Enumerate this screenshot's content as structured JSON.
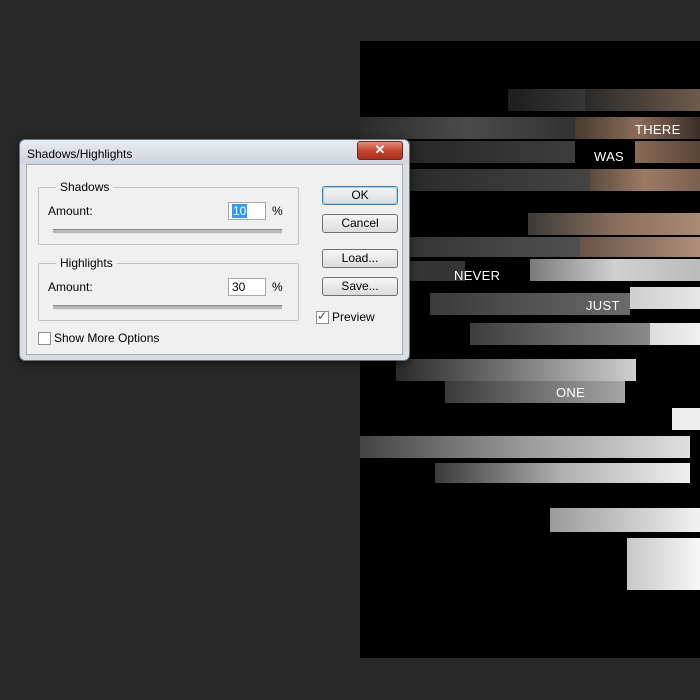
{
  "dialog": {
    "title": "Shadows/Highlights",
    "close_glyph": "✕",
    "shadows": {
      "title": "Shadows",
      "amount_label": "Amount:",
      "amount_value": "10",
      "unit": "%",
      "slider_level_percent": 10
    },
    "highlights": {
      "title": "Highlights",
      "amount_label": "Amount:",
      "amount_value": "30",
      "unit": "%",
      "slider_level_percent": 30
    },
    "buttons": {
      "ok": "OK",
      "cancel": "Cancel",
      "load": "Load...",
      "save": "Save..."
    },
    "preview": {
      "label": "Preview",
      "checked": true,
      "check_glyph": "✓"
    },
    "show_more": {
      "label": "Show More Options",
      "checked": false
    }
  },
  "poster": {
    "words": [
      "THERE",
      "WAS",
      "NEVER",
      "JUST",
      "ONE"
    ]
  },
  "colors": {
    "workspace": "#282828",
    "canvas": "#000000",
    "selection": "#3399ff",
    "close_button": "#c1412c"
  }
}
